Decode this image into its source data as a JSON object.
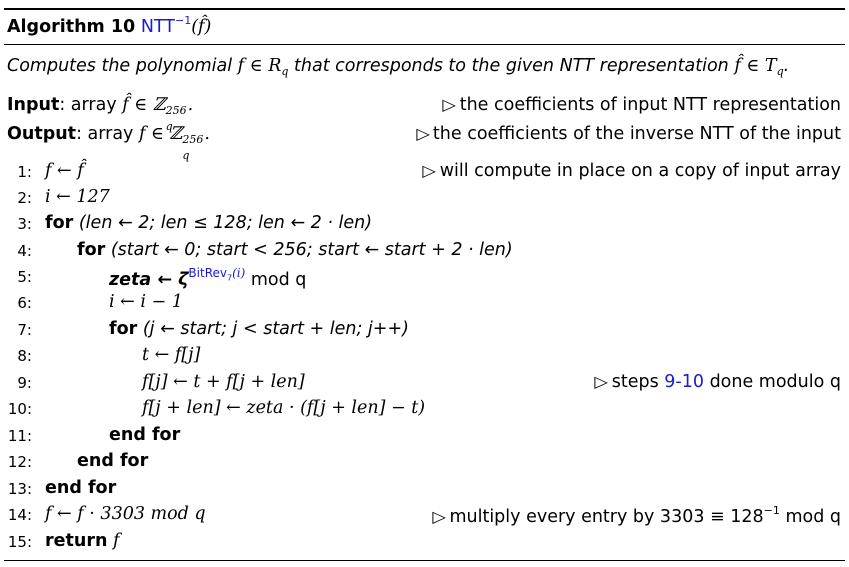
{
  "algorithm": {
    "label": "Algorithm 10",
    "name": "NTT",
    "name_sup": "−1",
    "arg": "(f̂)"
  },
  "caption": {
    "before": "Computes the polynomial",
    "math1": "f ∈ R",
    "math1_sub": "q",
    "middle": "that corresponds to the given NTT representation",
    "math2": "f̂ ∈ T",
    "math2_sub": "q",
    "end": "."
  },
  "input": {
    "label": "Input",
    "text": ": array",
    "math": "f̂ ∈ ℤ",
    "sup": "256",
    "sub": "q",
    "end": ".",
    "comment": "the coefficients of input NTT representation"
  },
  "output": {
    "label": "Output",
    "text": ": array",
    "math": "f ∈ ℤ",
    "sup": "256",
    "sub": "q",
    "end": ".",
    "comment": "the coefficients of the inverse NTT of the input"
  },
  "lines": [
    {
      "n": "1:",
      "code": "f ← f̂",
      "comment": "will compute in place on a copy of input array"
    },
    {
      "n": "2:",
      "code": "i ← 127"
    },
    {
      "n": "3:",
      "kw": "for",
      "code": "(len ← 2; len ≤ 128; len ← 2 · len)"
    },
    {
      "n": "4:",
      "kw": "for",
      "code": "(start ← 0; start < 256; start ← start + 2 · len)"
    },
    {
      "n": "5:",
      "code_a": "zeta ← ζ",
      "sup": "BitRev",
      "sup_sub": "7",
      "sup_tail": "(i)",
      "code_b": " mod q"
    },
    {
      "n": "6:",
      "code": "i ← i − 1"
    },
    {
      "n": "7:",
      "kw": "for",
      "code": "(j ← start; j < start + len; j++)"
    },
    {
      "n": "8:",
      "code": "t ← f[j]"
    },
    {
      "n": "9:",
      "code": "f[j] ← t + f[j + len]",
      "comment_a": "steps ",
      "comment_link": "9-10",
      "comment_b": " done modulo q"
    },
    {
      "n": "10:",
      "code": "f[j + len] ← zeta · (f[j + len] − t)"
    },
    {
      "n": "11:",
      "kw": "end for"
    },
    {
      "n": "12:",
      "kw": "end for"
    },
    {
      "n": "13:",
      "kw": "end for"
    },
    {
      "n": "14:",
      "code": "f ← f · 3303 mod q",
      "comment_a": "multiply every entry by 3303 ≡ 128",
      "comment_sup": "−1",
      "comment_b": " mod q"
    },
    {
      "n": "15:",
      "kw": "return",
      "code": "f"
    }
  ]
}
